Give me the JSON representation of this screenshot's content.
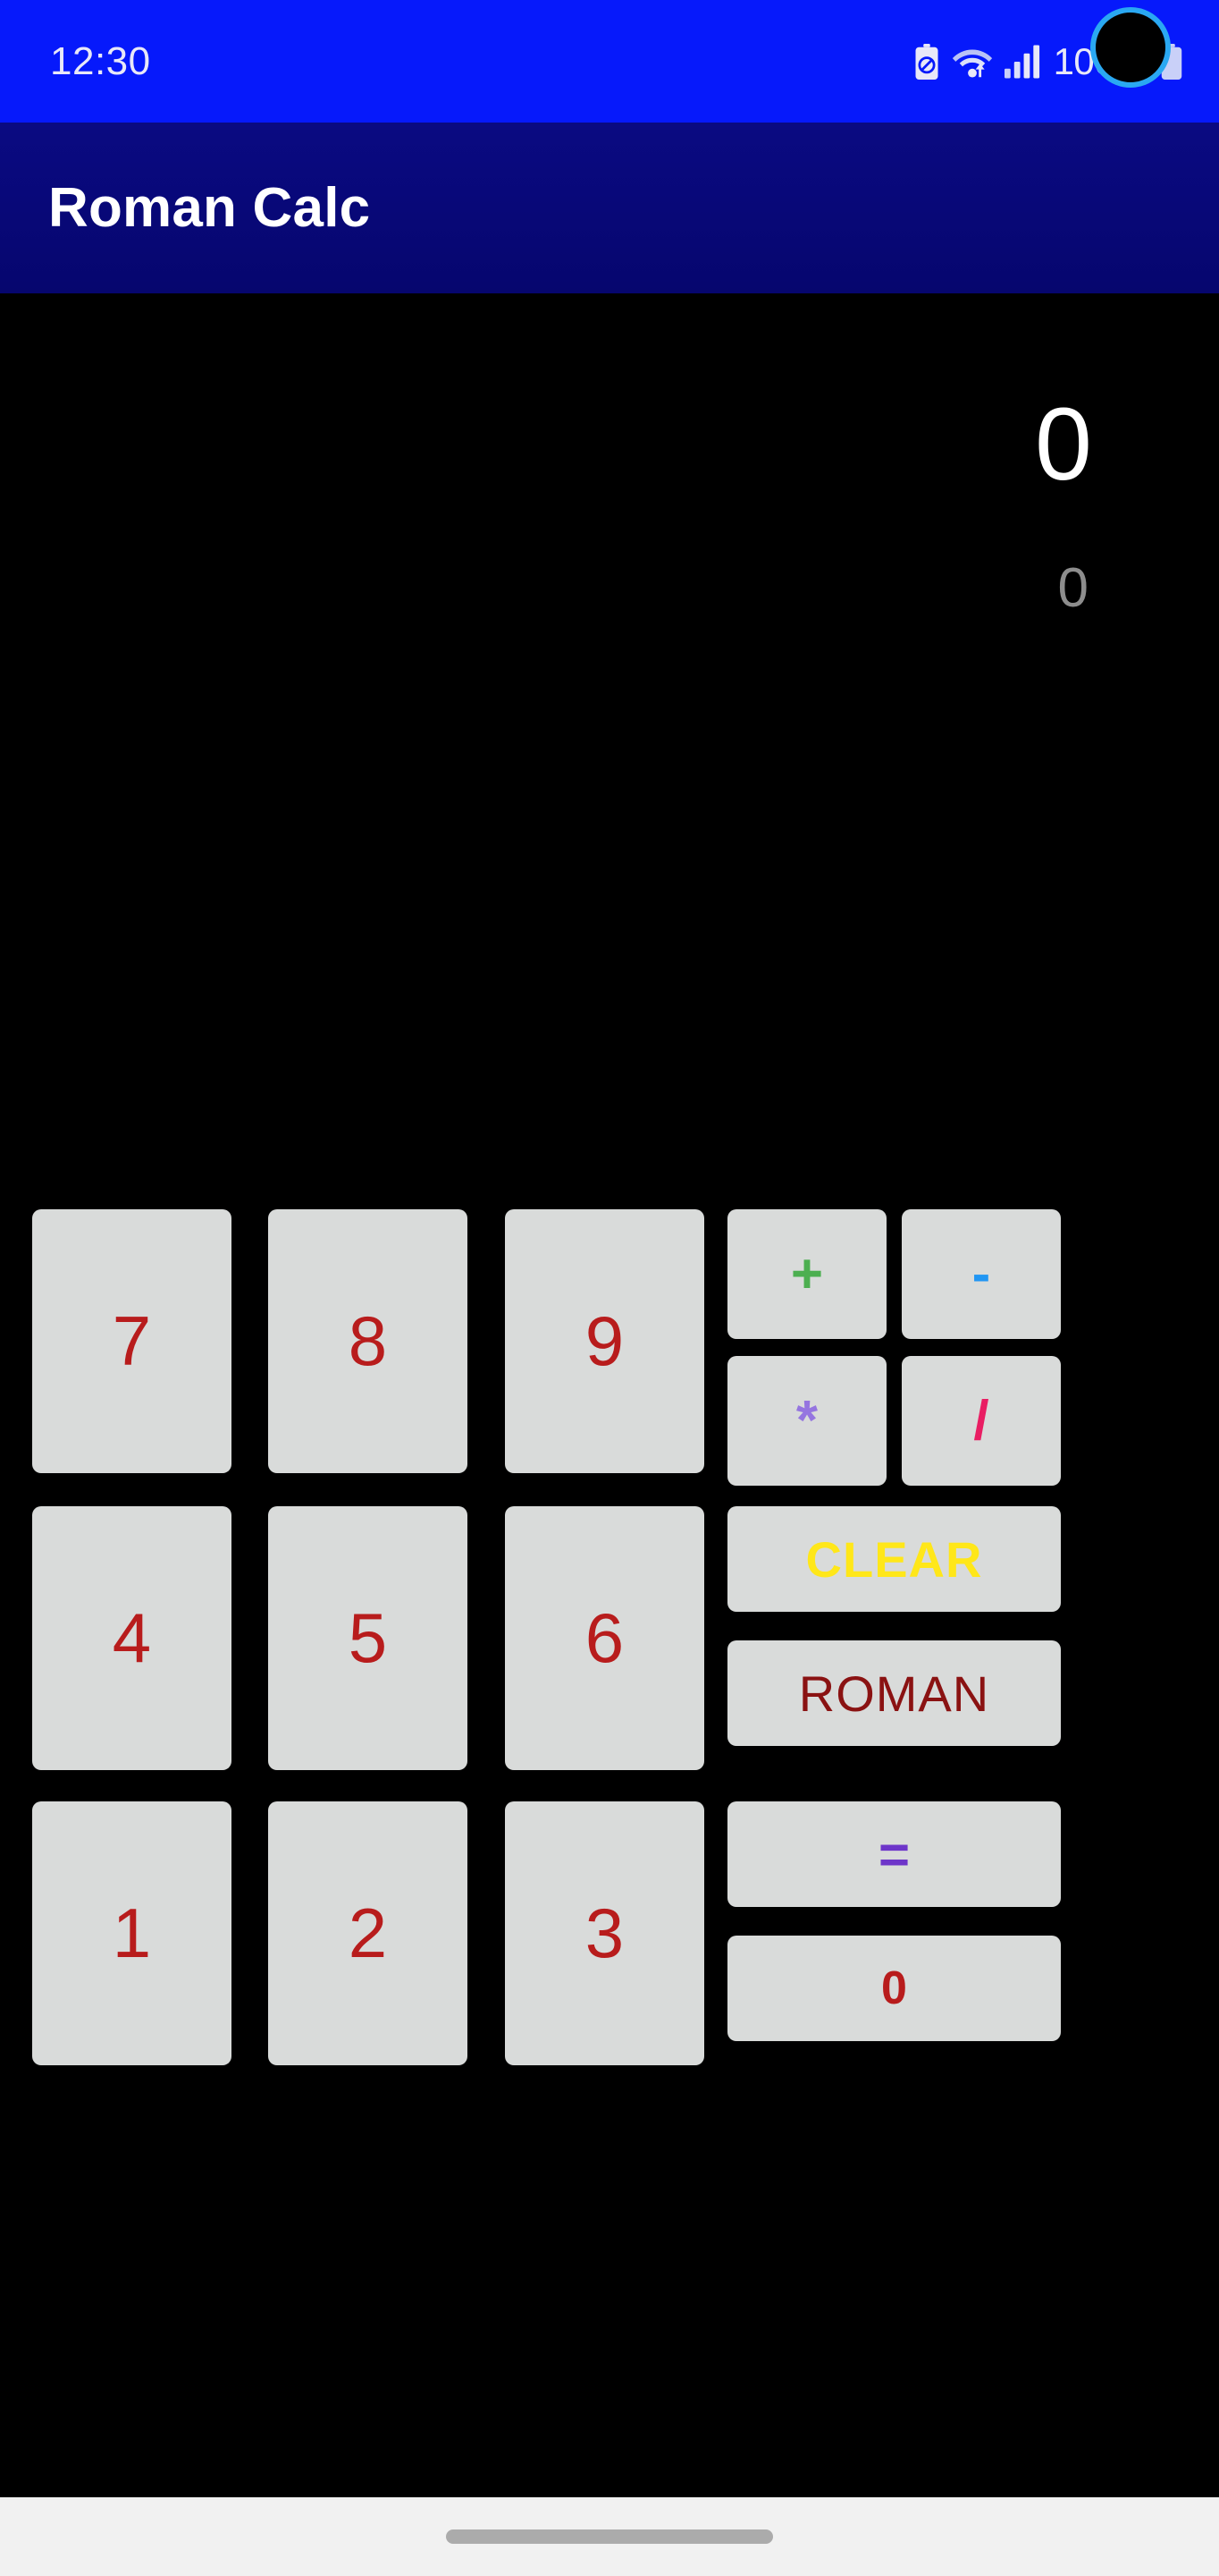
{
  "status_bar": {
    "time": "12:30",
    "battery_percent": "100%",
    "icons": [
      "battery-saver-icon",
      "wifi-icon",
      "signal-icon",
      "battery-icon"
    ],
    "background_color": "#0619FB",
    "text_color": "#E8E8F8",
    "camera_ring_color": "#2AA8F2"
  },
  "app_bar": {
    "title": "Roman Calc",
    "background_color": "#0A0A82",
    "title_color": "#FFFFFF"
  },
  "display": {
    "primary_value": "0",
    "secondary_value": "0",
    "primary_color": "#FFFFFF",
    "secondary_color": "#8D8D8D",
    "background_color": "#000000"
  },
  "keypad": {
    "button_face_color": "#D9DBDA",
    "numbers": [
      {
        "label": "7",
        "name": "key-7",
        "color": "#B81C1C"
      },
      {
        "label": "8",
        "name": "key-8",
        "color": "#B81C1C"
      },
      {
        "label": "9",
        "name": "key-9",
        "color": "#B81C1C"
      },
      {
        "label": "4",
        "name": "key-4",
        "color": "#B81C1C"
      },
      {
        "label": "5",
        "name": "key-5",
        "color": "#B81C1C"
      },
      {
        "label": "6",
        "name": "key-6",
        "color": "#B81C1C"
      },
      {
        "label": "1",
        "name": "key-1",
        "color": "#B81C1C"
      },
      {
        "label": "2",
        "name": "key-2",
        "color": "#B81C1C"
      },
      {
        "label": "3",
        "name": "key-3",
        "color": "#B81C1C"
      }
    ],
    "operators": [
      {
        "label": "+",
        "name": "key-plus",
        "color": "#4CAF50"
      },
      {
        "label": "-",
        "name": "key-minus",
        "color": "#2196F3"
      },
      {
        "label": "*",
        "name": "key-multiply",
        "color": "#9575E0"
      },
      {
        "label": "/",
        "name": "key-divide",
        "color": "#E91E63"
      }
    ],
    "actions": {
      "clear_label": "CLEAR",
      "clear_color": "#FFE719",
      "roman_label": "ROMAN",
      "roman_color": "#8A1212",
      "equals_label": "=",
      "equals_color": "#6D35C9",
      "zero_label": "0",
      "zero_color": "#B81C1C"
    }
  },
  "nav_bar": {
    "background_color": "#F1F1F1",
    "pill_color": "#ABABAB"
  }
}
